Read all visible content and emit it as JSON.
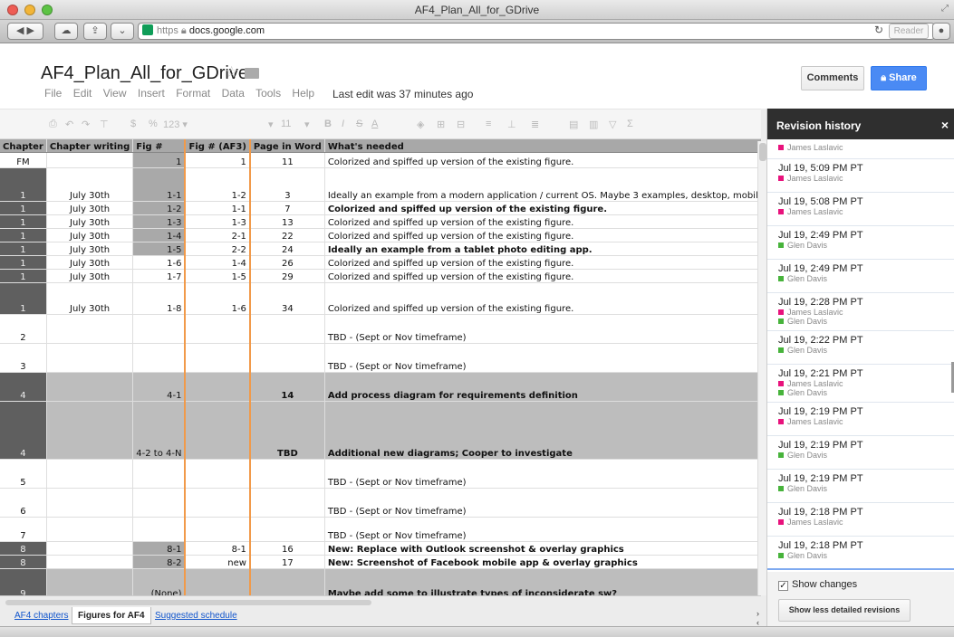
{
  "window": {
    "title": "AF4_Plan_All_for_GDrive"
  },
  "browser": {
    "url_scheme": "https",
    "url_host": "docs.google.com",
    "reader_label": "Reader"
  },
  "doc": {
    "title": "AF4_Plan_All_for_GDrive",
    "menu": [
      "File",
      "Edit",
      "View",
      "Insert",
      "Format",
      "Data",
      "Tools",
      "Help"
    ],
    "last_edit": "Last edit was 37 minutes ago",
    "comments_label": "Comments",
    "share_label": "Share"
  },
  "format_toolbar": {
    "currency": "$",
    "percent": "%",
    "number_format": "123 ▾",
    "font_size": "11",
    "bold": "B",
    "italic": "I",
    "strike": "S",
    "text_color": "A",
    "sum": "Σ"
  },
  "sheet": {
    "headers": [
      "Chapter",
      "Chapter writing",
      "Fig #",
      "Fig # (AF3)",
      "Page in Word",
      "What's needed"
    ],
    "rows": [
      {
        "h": 17,
        "chapter": "FM",
        "writing": "",
        "fig": "1",
        "af3": "1",
        "page": "11",
        "needed": "Colorized and spiffed up version of the existing figure.",
        "ch_style": "",
        "fig_style": "mid",
        "need_style": "",
        "need_bold": false
      },
      {
        "h": 37,
        "chapter": "1",
        "writing": "July 30th",
        "fig": "1-1",
        "af3": "1-2",
        "page": "3",
        "needed": "Ideally an example from a modern application / current OS. Maybe 3 examples, desktop, mobile",
        "ch_style": "dark",
        "fig_style": "mid",
        "need_style": "",
        "need_bold": false
      },
      {
        "h": 15,
        "chapter": "1",
        "writing": "July 30th",
        "fig": "1-2",
        "af3": "1-1",
        "page": "7",
        "needed": "Colorized and spiffed up version of the existing figure.",
        "ch_style": "dark",
        "fig_style": "mid",
        "need_style": "",
        "need_bold": true
      },
      {
        "h": 15,
        "chapter": "1",
        "writing": "July 30th",
        "fig": "1-3",
        "af3": "1-3",
        "page": "13",
        "needed": "Colorized and spiffed up version of the existing figure.",
        "ch_style": "dark",
        "fig_style": "mid",
        "need_style": "",
        "need_bold": false
      },
      {
        "h": 15,
        "chapter": "1",
        "writing": "July 30th",
        "fig": "1-4",
        "af3": "2-1",
        "page": "22",
        "needed": "Colorized and spiffed up version of the existing figure.",
        "ch_style": "dark",
        "fig_style": "mid",
        "need_style": "",
        "need_bold": false
      },
      {
        "h": 15,
        "chapter": "1",
        "writing": "July 30th",
        "fig": "1-5",
        "af3": "2-2",
        "page": "24",
        "needed": "Ideally an example from a tablet photo editing app.",
        "ch_style": "dark",
        "fig_style": "mid",
        "need_style": "",
        "need_bold": true
      },
      {
        "h": 15,
        "chapter": "1",
        "writing": "July 30th",
        "fig": "1-6",
        "af3": "1-4",
        "page": "26",
        "needed": "Colorized and spiffed up version of the existing figure.",
        "ch_style": "dark",
        "fig_style": "",
        "need_style": "",
        "need_bold": false
      },
      {
        "h": 15,
        "chapter": "1",
        "writing": "July 30th",
        "fig": "1-7",
        "af3": "1-5",
        "page": "29",
        "needed": "Colorized and spiffed up version of the existing figure.",
        "ch_style": "dark",
        "fig_style": "",
        "need_style": "",
        "need_bold": false
      },
      {
        "h": 35,
        "chapter": "1",
        "writing": "July 30th",
        "fig": "1-8",
        "af3": "1-6",
        "page": "34",
        "needed": "Colorized and spiffed up version of the existing figure.",
        "ch_style": "dark",
        "fig_style": "",
        "need_style": "",
        "need_bold": false
      },
      {
        "h": 32,
        "chapter": "2",
        "writing": "",
        "fig": "",
        "af3": "",
        "page": "",
        "needed": "TBD - (Sept or Nov timeframe)",
        "ch_style": "",
        "fig_style": "",
        "need_style": "",
        "need_bold": false
      },
      {
        "h": 32,
        "chapter": "3",
        "writing": "",
        "fig": "",
        "af3": "",
        "page": "",
        "needed": "TBD - (Sept or Nov timeframe)",
        "ch_style": "",
        "fig_style": "",
        "need_style": "",
        "need_bold": false
      },
      {
        "h": 32,
        "chapter": "4",
        "writing": "",
        "fig": "4-1",
        "af3": "",
        "page": "14",
        "needed": "Add process diagram for requirements definition",
        "ch_style": "dark",
        "fig_style": "gray",
        "need_style": "gray",
        "need_bold": true
      },
      {
        "h": 64,
        "chapter": "4",
        "writing": "",
        "fig": "4-2 to 4-N",
        "af3": "",
        "page": "TBD",
        "needed": "Additional new diagrams; Cooper to investigate",
        "ch_style": "dark",
        "fig_style": "gray",
        "need_style": "gray",
        "need_bold": true
      },
      {
        "h": 32,
        "chapter": "5",
        "writing": "",
        "fig": "",
        "af3": "",
        "page": "",
        "needed": "TBD - (Sept or Nov timeframe)",
        "ch_style": "",
        "fig_style": "",
        "need_style": "",
        "need_bold": false
      },
      {
        "h": 32,
        "chapter": "6",
        "writing": "",
        "fig": "",
        "af3": "",
        "page": "",
        "needed": "TBD - (Sept or Nov timeframe)",
        "ch_style": "",
        "fig_style": "",
        "need_style": "",
        "need_bold": false
      },
      {
        "h": 27,
        "chapter": "7",
        "writing": "",
        "fig": "",
        "af3": "",
        "page": "",
        "needed": "TBD - (Sept or Nov timeframe)",
        "ch_style": "",
        "fig_style": "",
        "need_style": "",
        "need_bold": false
      },
      {
        "h": 15,
        "chapter": "8",
        "writing": "",
        "fig": "8-1",
        "af3": "8-1",
        "page": "16",
        "needed": "New: Replace with Outlook screenshot & overlay graphics",
        "ch_style": "dark",
        "fig_style": "mid",
        "need_style": "",
        "need_bold": true
      },
      {
        "h": 15,
        "chapter": "8",
        "writing": "",
        "fig": "8-2",
        "af3": "new",
        "page": "17",
        "needed": "New: Screenshot of Facebook mobile app & overlay graphics",
        "ch_style": "dark",
        "fig_style": "mid",
        "need_style": "",
        "need_bold": true
      },
      {
        "h": 34,
        "chapter": "9",
        "writing": "",
        "fig": "(None)",
        "af3": "",
        "page": "",
        "needed": "Maybe add some to illustrate types of inconsiderate sw?",
        "ch_style": "dark",
        "fig_style": "gray",
        "need_style": "gray",
        "need_bold": true
      }
    ]
  },
  "sheet_tabs": [
    {
      "label": "AF4 chapters",
      "active": false
    },
    {
      "label": "Figures for AF4",
      "active": true
    },
    {
      "label": "Suggested schedule",
      "active": false
    }
  ],
  "revision_panel": {
    "title": "Revision history",
    "close": "×",
    "items": [
      {
        "date": "",
        "users": [
          {
            "name": "James Laslavic",
            "color": "#e8127c"
          }
        ]
      },
      {
        "date": "Jul 19, 5:09 PM PT",
        "users": [
          {
            "name": "James Laslavic",
            "color": "#e8127c"
          }
        ]
      },
      {
        "date": "Jul 19, 5:08 PM PT",
        "users": [
          {
            "name": "James Laslavic",
            "color": "#e8127c"
          }
        ]
      },
      {
        "date": "Jul 19, 2:49 PM PT",
        "users": [
          {
            "name": "Glen Davis",
            "color": "#47b33b"
          }
        ]
      },
      {
        "date": "Jul 19, 2:49 PM PT",
        "users": [
          {
            "name": "Glen Davis",
            "color": "#47b33b"
          }
        ]
      },
      {
        "date": "Jul 19, 2:28 PM PT",
        "users": [
          {
            "name": "James Laslavic",
            "color": "#e8127c"
          },
          {
            "name": "Glen Davis",
            "color": "#47b33b"
          }
        ]
      },
      {
        "date": "Jul 19, 2:22 PM PT",
        "users": [
          {
            "name": "Glen Davis",
            "color": "#47b33b"
          }
        ]
      },
      {
        "date": "Jul 19, 2:21 PM PT",
        "users": [
          {
            "name": "James Laslavic",
            "color": "#e8127c"
          },
          {
            "name": "Glen Davis",
            "color": "#47b33b"
          }
        ]
      },
      {
        "date": "Jul 19, 2:19 PM PT",
        "users": [
          {
            "name": "James Laslavic",
            "color": "#e8127c"
          }
        ]
      },
      {
        "date": "Jul 19, 2:19 PM PT",
        "users": [
          {
            "name": "Glen Davis",
            "color": "#47b33b"
          }
        ]
      },
      {
        "date": "Jul 19, 2:19 PM PT",
        "users": [
          {
            "name": "Glen Davis",
            "color": "#47b33b"
          }
        ]
      },
      {
        "date": "Jul 19, 2:18 PM PT",
        "users": [
          {
            "name": "James Laslavic",
            "color": "#e8127c"
          }
        ]
      },
      {
        "date": "Jul 19, 2:18 PM PT",
        "users": [
          {
            "name": "Glen Davis",
            "color": "#47b33b"
          }
        ]
      }
    ],
    "show_changes_label": "Show changes",
    "show_changes_checked": true,
    "less_detail_label": "Show less detailed revisions"
  }
}
